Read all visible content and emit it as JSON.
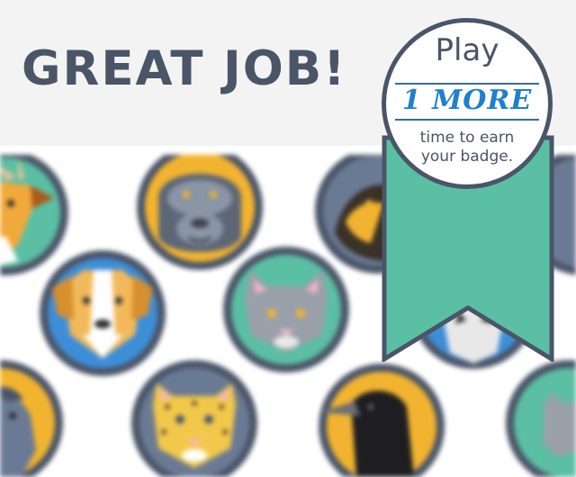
{
  "header": {
    "title": "GREAT JOB!"
  },
  "seal": {
    "top_word": "Play",
    "highlight": "1 MORE",
    "line1": "time to earn",
    "line2": "your badge."
  },
  "badges": [
    {
      "animal": "antelope",
      "icon": "antelope-icon",
      "bg": "#5bbfa4",
      "ring": "#f3f3f3"
    },
    {
      "animal": "gorilla",
      "icon": "gorilla-icon",
      "bg": "#f2b430",
      "ring": "#4a5568"
    },
    {
      "animal": "bird",
      "icon": "bird-icon",
      "bg": "#6b7a94",
      "ring": "#4a5568"
    },
    {
      "animal": "dog",
      "icon": "dog-icon",
      "bg": "#3d8ed8",
      "ring": "#4a5568"
    },
    {
      "animal": "cat",
      "icon": "cat-icon",
      "bg": "#5bbfa4",
      "ring": "#4a5568"
    },
    {
      "animal": "horse",
      "icon": "horse-icon",
      "bg": "#f2b430",
      "ring": "#4a5568"
    },
    {
      "animal": "leopard",
      "icon": "leopard-icon",
      "bg": "#6b7a94",
      "ring": "#4a5568"
    },
    {
      "animal": "crow",
      "icon": "crow-icon",
      "bg": "#f2b430",
      "ring": "#4a5568"
    },
    {
      "animal": "wolf",
      "icon": "wolf-icon",
      "bg": "#5bbfa4",
      "ring": "#4a5568"
    }
  ],
  "colors": {
    "ink": "#4a5568",
    "ribbon": "#5bbfa4",
    "highlight": "#1f7fcf",
    "header_bg": "#f3f3f3"
  }
}
